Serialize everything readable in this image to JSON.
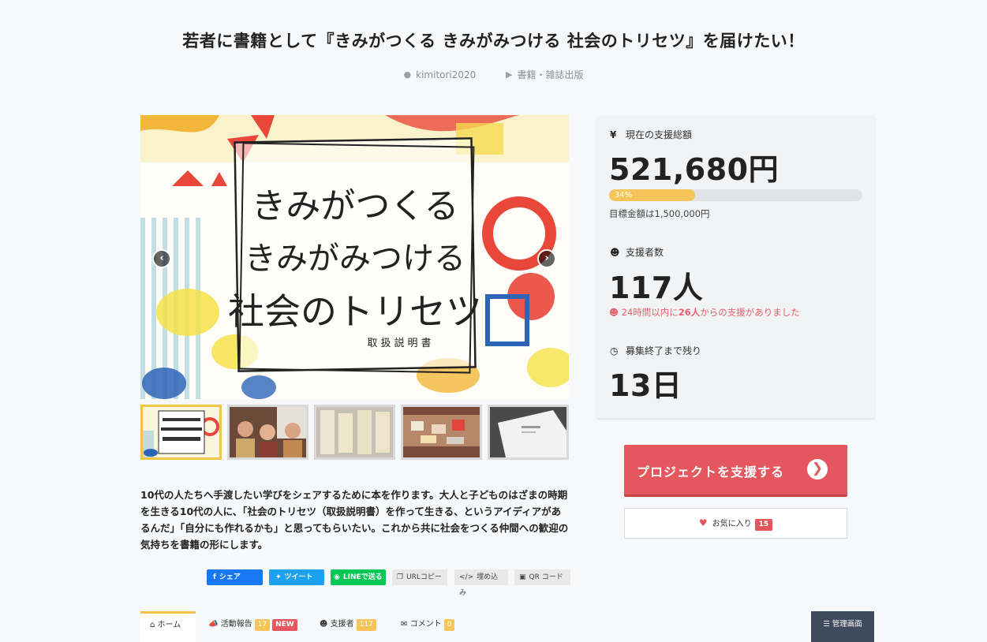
{
  "header": {
    "title": "若者に書籍として『きみがつくる きみがみつける 社会のトリセツ』を届けたい！",
    "author": "kimitori2020",
    "category": "書籍・雑誌出版"
  },
  "gallery": {
    "cover_lines": [
      "きみがつくる",
      "きみがみつける",
      "社会のトリセツ"
    ],
    "cover_sub": "取扱説明書",
    "prev_icon": "chevron-left-icon",
    "next_icon": "chevron-right-icon",
    "active_thumb": 0,
    "thumb_count": 5
  },
  "description": "10代の人たちへ手渡したい学びをシェアするために本を作ります。大人と子どものはざまの時期を生きる10代の人に、「社会のトリセツ（取扱説明書）を作って生きる、というアイディアがあるんだ」「自分にも作れるかも」と思ってもらいたい。これから共に社会をつくる仲間への歓迎の気持ちを書籍の形にします。",
  "share": {
    "facebook": "シェア",
    "twitter": "ツイート",
    "line": "LINEで送る",
    "url": "URLコピー",
    "embed": "埋め込み",
    "qr": "QR コード"
  },
  "stats": {
    "total_label": "現在の支援総額",
    "total_icon": "¥",
    "total_value": "521,680円",
    "progress_label": "34%",
    "progress_fraction": 0.34,
    "goal_text": "目標金額は1,500,000円",
    "backers_label": "支援者数",
    "backers_value": "117人",
    "recent_prefix": "24時間以内に",
    "recent_count": "26人",
    "recent_suffix": "からの支援がありました",
    "days_label": "募集終了まで残り",
    "days_value": "13日"
  },
  "actions": {
    "support_label": "プロジェクトを支援する",
    "fav_label": "お気に入り",
    "fav_count": "15"
  },
  "tabs": {
    "home": "ホーム",
    "reports": "活動報告",
    "reports_count": "17",
    "reports_new": "NEW",
    "backers": "支援者",
    "backers_count": "117",
    "comments": "コメント",
    "comments_count": "0",
    "admin": "管理画面"
  },
  "colors": {
    "accent_red": "#e5575f",
    "accent_yellow": "#f6c55a",
    "admin_bg": "#3d4b5c"
  }
}
